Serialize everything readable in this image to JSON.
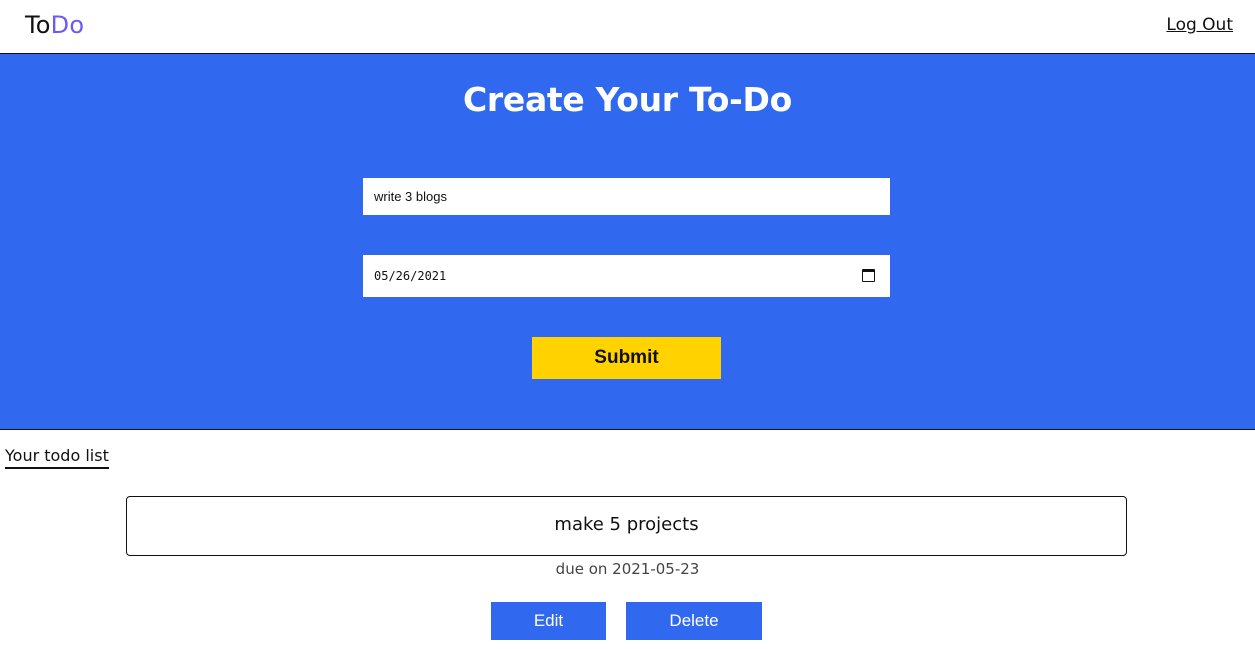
{
  "navbar": {
    "logo_part1": "To",
    "logo_part2": "Do",
    "logout_label": "Log Out"
  },
  "form": {
    "title": "Create Your To-Do",
    "task_value": "write 3 blogs",
    "date_value": "05/26/2021",
    "submit_label": "Submit"
  },
  "list": {
    "heading": "Your todo list",
    "items": [
      {
        "title": "make 5 projects",
        "due": "due on 2021-05-23",
        "edit_label": "Edit",
        "delete_label": "Delete"
      }
    ]
  },
  "colors": {
    "hero_bg": "#3069f0",
    "submit_bg": "#ffd200",
    "logo_accent": "#6a5af9",
    "action_bg": "#3069f0"
  },
  "icons": [
    "calendar-icon"
  ]
}
